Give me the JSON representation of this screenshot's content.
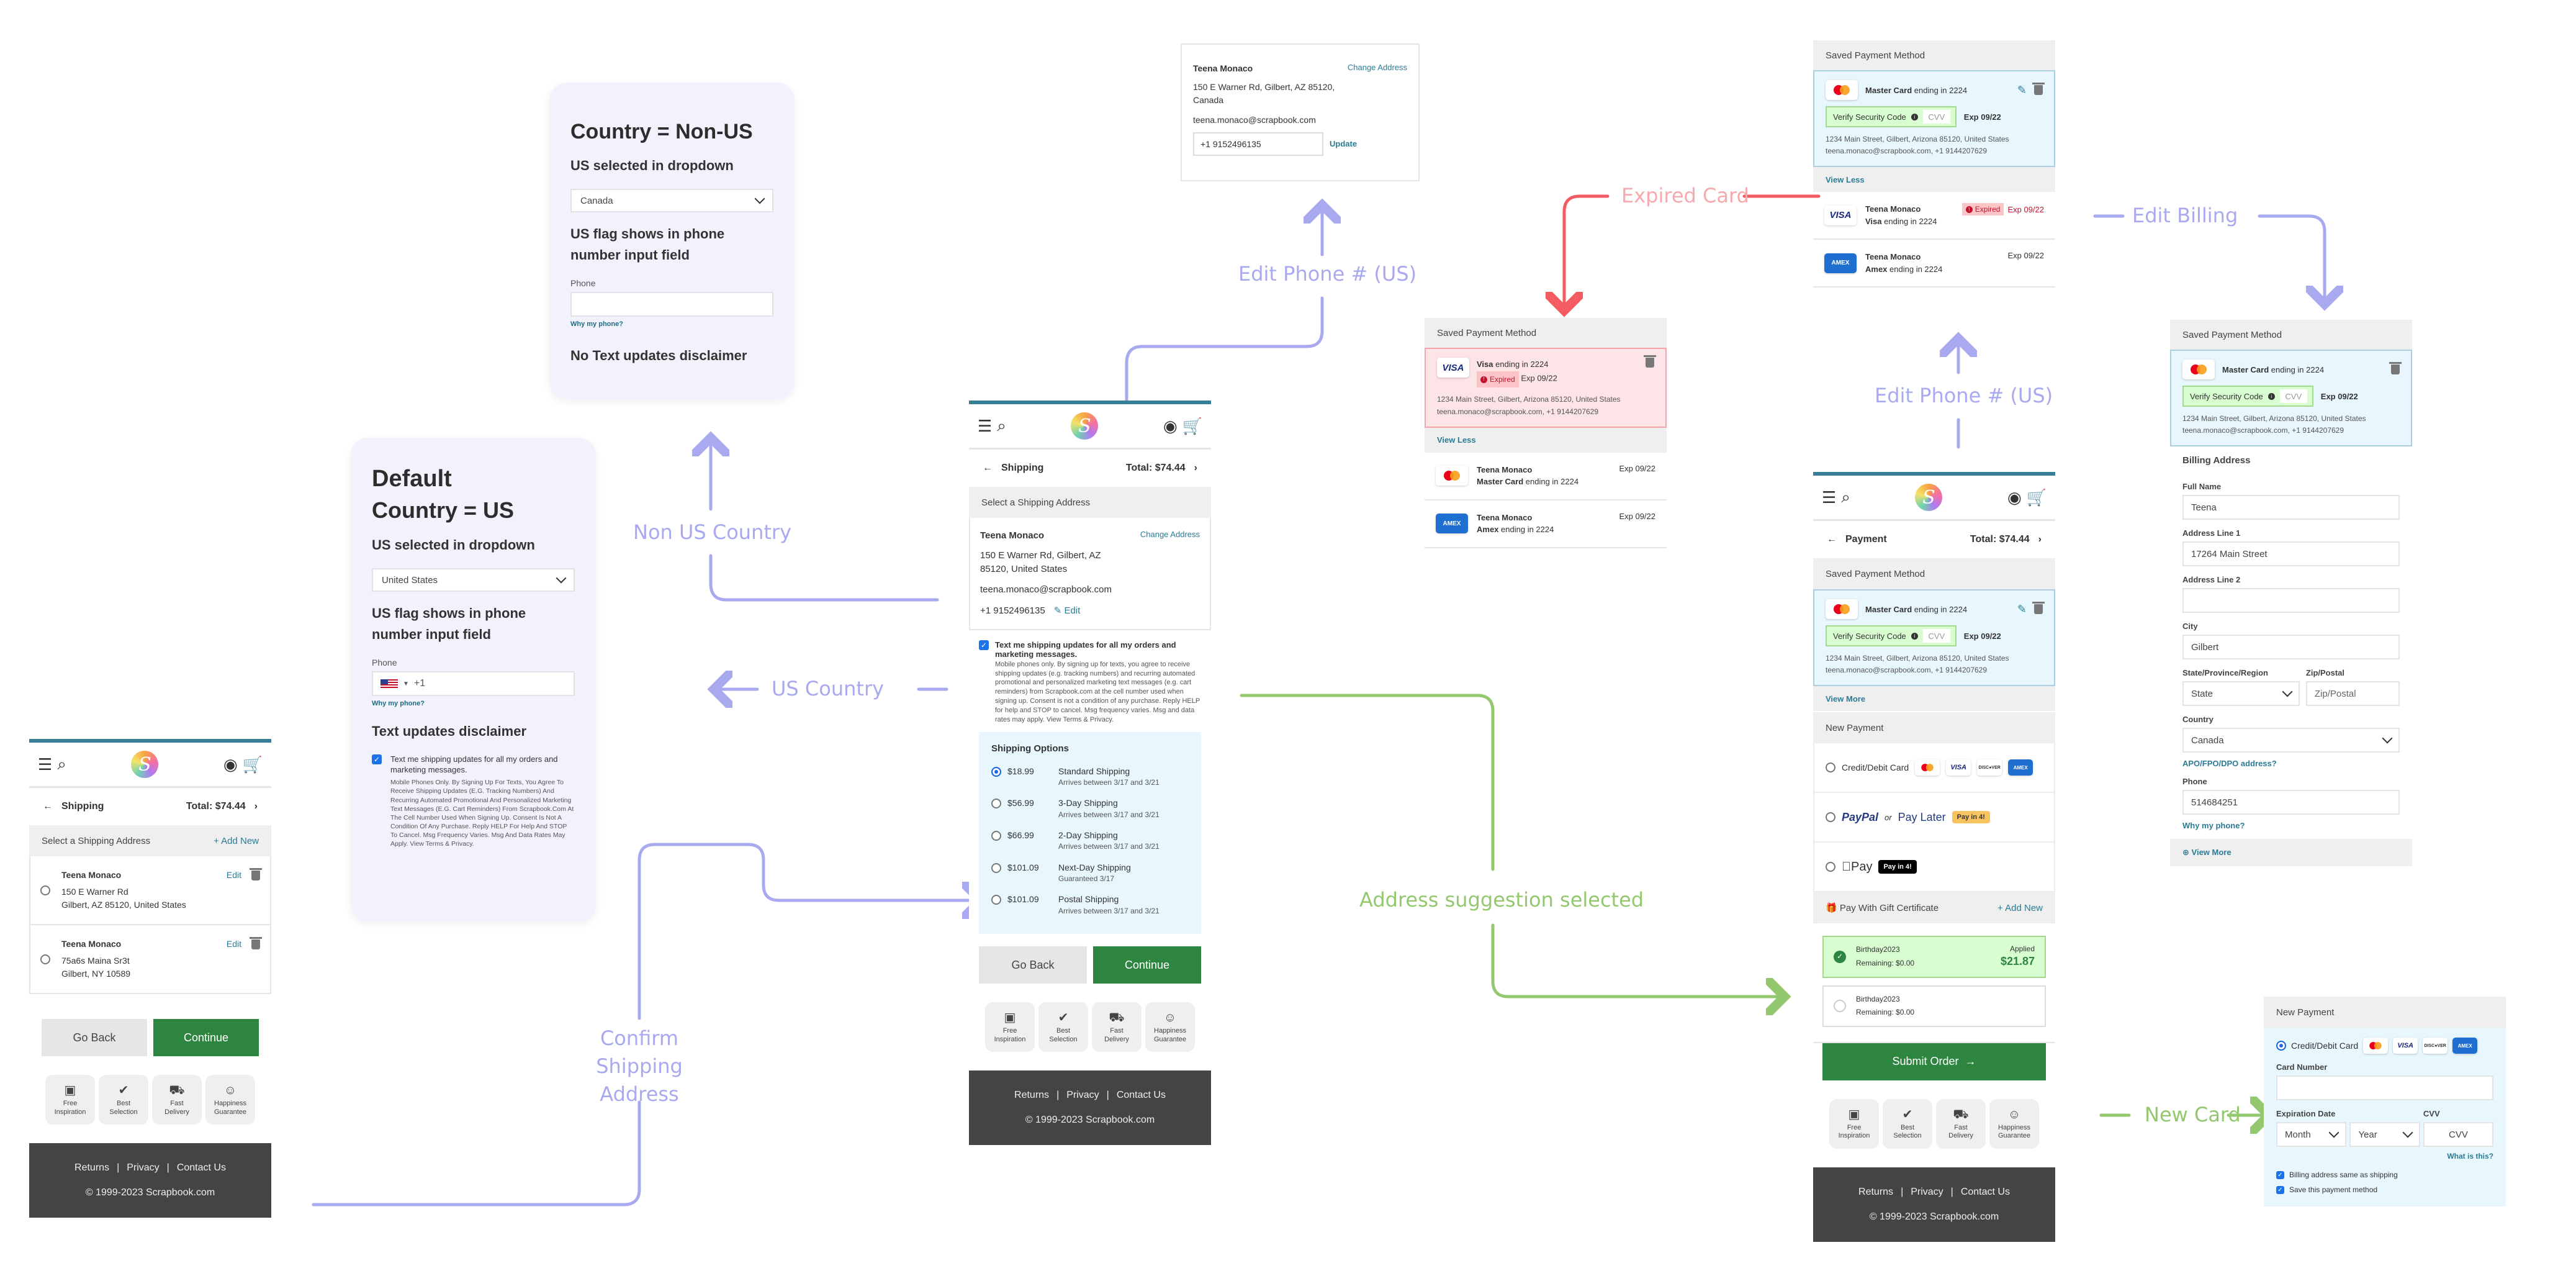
{
  "flow_labels": {
    "non_us_country": "Non US Country",
    "us_country": "US Country",
    "confirm_shipping": "Confirm Shipping Address",
    "edit_phone_us_1": "Edit Phone # (US)",
    "address_suggestion": "Address suggestion selected",
    "expired_card": "Expired Card",
    "edit_billing": "Edit Billing",
    "edit_phone_us_2": "Edit Phone # (US)",
    "new_card": "New Card"
  },
  "colors": {
    "purple_flow": "#a9a9f0",
    "green_flow": "#93c86f",
    "red_flow": "#f25b62",
    "brand_teal": "#3a7f98",
    "continue_green": "#2e8540"
  },
  "note_default": {
    "title": "Default",
    "subtitle": "Country = US",
    "dropdown_heading": "US selected in dropdown",
    "dropdown_value": "United States",
    "phone_heading": "US flag shows in phone number input field",
    "phone_label": "Phone",
    "phone_prefix": "+1",
    "why_phone": "Why my phone?",
    "disclaimer_heading": "Text updates disclaimer",
    "checkbox_label": "Text me shipping updates for all my orders and marketing messages.",
    "disclaimer_text": "Mobile Phones Only. By Signing Up For Texts, You Agree To Receive Shipping Updates (E.G. Tracking Numbers) And Recurring Automated Promotional And Personalized Marketing Text Messages (E.G. Cart Reminders) From Scrapbook.Com At The Cell Number Used When Signing Up. Consent Is Not A Condition Of Any Purchase. Reply HELP For Help And STOP To Cancel. Msg Frequency Varies. Msg And Data Rates May Apply. View Terms & Privacy."
  },
  "note_non_us": {
    "title": "Country = Non-US",
    "dropdown_heading": "US selected in dropdown",
    "dropdown_value": "Canada",
    "phone_heading": "US flag shows in phone number input field",
    "phone_label": "Phone",
    "why_phone": "Why my phone?",
    "disclaimer_heading": "No Text updates disclaimer"
  },
  "common": {
    "total": "Total: $74.44",
    "go_back": "Go Back",
    "continue": "Continue",
    "badges": [
      {
        "icon": "images-icon",
        "glyph": "▣",
        "label": "Free Inspiration"
      },
      {
        "icon": "check-icon",
        "glyph": "✔",
        "label": "Best Selection"
      },
      {
        "icon": "truck-icon",
        "glyph": "⛟",
        "label": "Fast Delivery"
      },
      {
        "icon": "smile-icon",
        "glyph": "☺",
        "label": "Happiness Guarantee"
      }
    ],
    "footer_links": [
      "Returns",
      "Privacy",
      "Contact Us"
    ],
    "footer_sep": "|",
    "copyright": "© 1999-2023 Scrapbook.com",
    "logo_letter": "S"
  },
  "screen_shipping_list": {
    "step": "Shipping",
    "section": "Select a Shipping Address",
    "add_new": "+ Add New",
    "addresses": [
      {
        "name": "Teena Monaco",
        "line1": "150 E Warner Rd",
        "line2": "Gilbert, AZ 85120, United States",
        "edit": "Edit"
      },
      {
        "name": "Teena Monaco",
        "line1": "75a6s Maina Sr3t",
        "line2": "Gilbert, NY 10589",
        "edit": "Edit"
      }
    ]
  },
  "screen_shipping_main": {
    "step": "Shipping",
    "section": "Select a Shipping Address",
    "name": "Teena Monaco",
    "change_address": "Change Address",
    "address": "150 E Warner Rd, Gilbert, AZ 85120, United States",
    "email": "teena.monaco@scrapbook.com",
    "phone": "+1 9152496135",
    "edit": "Edit",
    "sms_label": "Text me shipping updates for all my orders and marketing messages.",
    "sms_text": "Mobile phones only. By signing up for texts, you agree to receive shipping updates (e.g. tracking numbers) and recurring automated promotional and personalized marketing text messages (e.g. cart reminders) from Scrapbook.com at the cell number used when signing up. Consent is not a condition of any purchase. Reply HELP for help and STOP to cancel. Msg frequency varies. Msg and data rates may apply. View Terms & Privacy.",
    "options_title": "Shipping Options",
    "options": [
      {
        "price": "$18.99",
        "name": "Standard Shipping",
        "detail": "Arrives between 3/17 and 3/21",
        "selected": true
      },
      {
        "price": "$56.99",
        "name": "3-Day Shipping",
        "detail": "Arrives between 3/17 and 3/21",
        "selected": false
      },
      {
        "price": "$66.99",
        "name": "2-Day Shipping",
        "detail": "Arrives between 3/17 and 3/21",
        "selected": false
      },
      {
        "price": "$101.09",
        "name": "Next-Day Shipping",
        "detail": "Guaranteed 3/17",
        "selected": false
      },
      {
        "price": "$101.09",
        "name": "Postal Shipping",
        "detail": "Arrives between 3/17 and 3/21",
        "selected": false
      }
    ]
  },
  "edit_phone_card": {
    "name": "Teena Monaco",
    "change_address": "Change Address",
    "address": "150 E Warner Rd, Gilbert, AZ 85120, Canada",
    "email": "teena.monaco@scrapbook.com",
    "phone_value": "+1 9152496135",
    "update": "Update"
  },
  "expired_panel": {
    "title": "Saved Payment Method",
    "selected_card": {
      "brand": "VISA",
      "label": "Visa",
      "ending": "ending in 2224",
      "expired": "Expired",
      "exp": "Exp 09/22",
      "address": "1234 Main Street, Gilbert, Arizona 85120, United States",
      "contact": "teena.monaco@scrapbook.com, +1 9144207629"
    },
    "view_less": "View Less",
    "others": [
      {
        "brand": "mastercard",
        "name": "Teena Monaco",
        "label": "Master Card",
        "ending": "ending in 2224",
        "exp": "Exp 09/22"
      },
      {
        "brand": "AMEX",
        "name": "Teena Monaco",
        "label": "Amex",
        "ending": "ending in 2224",
        "exp": "Exp 09/22"
      }
    ]
  },
  "saved_panel_top": {
    "title": "Saved Payment Method",
    "selected_card": {
      "label": "Master Card",
      "ending": "ending in 2224",
      "verify": "Verify Security Code",
      "cvv_placeholder": "CVV",
      "exp": "Exp 09/22",
      "address": "1234 Main Street, Gilbert, Arizona 85120, United States",
      "contact": "teena.monaco@scrapbook.com, +1 9144207629"
    },
    "view_less": "View Less",
    "others": [
      {
        "brand": "VISA",
        "name": "Teena Monaco",
        "label": "Visa",
        "ending": "ending in 2224",
        "expired": "Expired",
        "exp": "Exp 09/22"
      },
      {
        "brand": "AMEX",
        "name": "Teena Monaco",
        "label": "Amex",
        "ending": "ending in 2224",
        "exp": "Exp 09/22"
      }
    ]
  },
  "screen_payment": {
    "step": "Payment",
    "saved_title": "Saved Payment Method",
    "card": {
      "label": "Master Card",
      "ending": "ending in 2224",
      "verify": "Verify Security Code",
      "cvv_placeholder": "CVV",
      "exp": "Exp 09/22",
      "address": "1234 Main Street, Gilbert, Arizona 85120, United States",
      "contact": "teena.monaco@scrapbook.com, +1 9144207629"
    },
    "view_more": "View More",
    "new_payment": "New Payment",
    "credit_label": "Credit/Debit Card",
    "paypal": "PayPal",
    "or": "or",
    "pay_later": "Pay Later",
    "pay_in_4": "Pay in 4!",
    "apple_pay": "Pay",
    "gift_title": "Pay With Gift Certificate",
    "gift_add": "+ Add New",
    "gifts": [
      {
        "code": "Birthday2023",
        "remaining": "Remaining: $0.00",
        "applied_label": "Applied",
        "applied_amount": "$21.87",
        "applied": true
      },
      {
        "code": "Birthday2023",
        "remaining": "Remaining: $0.00",
        "applied": false
      }
    ],
    "submit": "Submit Order"
  },
  "billing_panel": {
    "title": "Saved Payment Method",
    "card": {
      "label": "Master Card",
      "ending": "ending in 2224",
      "verify": "Verify Security Code",
      "cvv_placeholder": "CVV",
      "exp": "Exp 09/22",
      "address": "1234 Main Street, Gilbert, Arizona 85120, United States",
      "contact": "teena.monaco@scrapbook.com, +1 9144207629"
    },
    "billing_title": "Billing Address",
    "full_name_label": "Full Name",
    "full_name": "Teena",
    "addr1_label": "Address Line 1",
    "addr1": "17264 Main Street",
    "addr2_label": "Address Line 2",
    "addr2": "",
    "city_label": "City",
    "city": "Gilbert",
    "state_label": "State/Province/Region",
    "state": "State",
    "zip_label": "Zip/Postal",
    "zip_placeholder": "Zip/Postal",
    "country_label": "Country",
    "country": "Canada",
    "apo": "APO/FPO/DPO address?",
    "phone_label": "Phone",
    "phone": "514684251",
    "why_phone": "Why my phone?",
    "view_more": "View More"
  },
  "new_card_panel": {
    "title": "New Payment",
    "credit_label": "Credit/Debit Card",
    "card_number_label": "Card Number",
    "exp_label": "Expiration Date",
    "month": "Month",
    "year": "Year",
    "cvv_label": "CVV",
    "cvv_placeholder": "CVV",
    "what_is_this": "What is this?",
    "billing_same": "Billing address same as shipping",
    "save_method": "Save this payment method"
  }
}
